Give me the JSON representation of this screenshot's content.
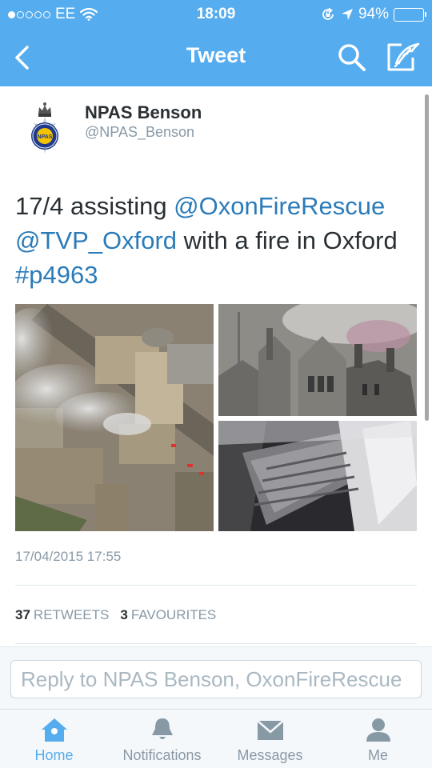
{
  "status_bar": {
    "carrier": "EE",
    "time": "18:09",
    "battery_percent": "94%",
    "battery_level": 0.94,
    "signal_bars": 1
  },
  "nav": {
    "title": "Tweet",
    "back_icon": "chevron-left-icon",
    "search_icon": "search-icon",
    "compose_icon": "compose-icon"
  },
  "tweet": {
    "author_name": "NPAS Benson",
    "author_handle": "@NPAS_Benson",
    "avatar_text": "NPAS",
    "text": {
      "prefix": "17/4 assisting ",
      "mention_1": "@OxonFireRescue",
      "mention_2": "@TVP_Oxford",
      "middle": " with a fire in Oxford",
      "hashtag": "#p4963"
    },
    "timestamp": "17/04/2015 17:55",
    "retweets_count": "37",
    "retweets_label": "RETWEETS",
    "favourites_count": "3",
    "favourites_label": "FAVOURITES"
  },
  "reply": {
    "placeholder": "Reply to NPAS Benson, OxonFireRescue"
  },
  "tabs": [
    {
      "label": "Home",
      "icon": "home-icon",
      "active": true
    },
    {
      "label": "Notifications",
      "icon": "bell-icon",
      "active": false
    },
    {
      "label": "Messages",
      "icon": "envelope-icon",
      "active": false
    },
    {
      "label": "Me",
      "icon": "person-icon",
      "active": false
    }
  ],
  "colors": {
    "brand": "#55acee",
    "link": "#2b7bb9",
    "text": "#292f33",
    "muted": "#8899a6"
  }
}
